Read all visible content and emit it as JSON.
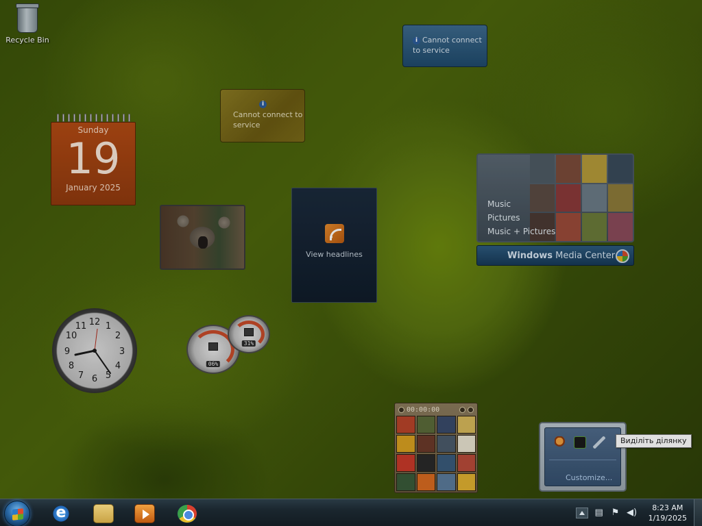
{
  "desktop": {
    "recycle_bin_label": "Recycle Bin"
  },
  "gadgets": {
    "calendar": {
      "weekday": "Sunday",
      "day": "19",
      "month_year": "January 2025"
    },
    "weather": {
      "message": "Cannot connect to service"
    },
    "currency": {
      "message": "Cannot connect to service"
    },
    "feed_headlines": {
      "label": "View headlines"
    },
    "media_center": {
      "items": [
        "Music",
        "Pictures",
        "Music + Pictures"
      ],
      "brand_strong": "Windows",
      "brand_rest": " Media Center"
    },
    "cpu_meter": {
      "cpu_value": "06%",
      "memory_value": "31%"
    },
    "picture_puzzle": {
      "timer": "00:00:00"
    },
    "gadget_picker": {
      "customize_label": "Customize...",
      "tooltip": "Виділіть ділянку"
    }
  },
  "taskbar": {
    "apps": [
      "internet-explorer",
      "windows-explorer",
      "windows-media-player",
      "google-chrome"
    ],
    "clock": {
      "time": "8:23 AM",
      "date": "1/19/2025"
    }
  },
  "colors": {
    "calendar_orange": "#a84412",
    "taskbar_dark": "#1a262e",
    "media_center_blue": "#1f4a6c"
  }
}
